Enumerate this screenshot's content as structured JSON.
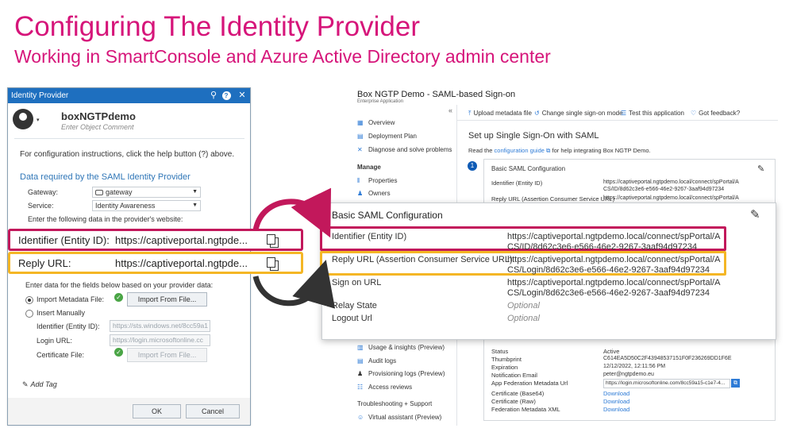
{
  "slide": {
    "title": "Configuring The Identity Provider",
    "subtitle": "Working in SmartConsole and Azure Active Directory admin center",
    "colors": {
      "accent": "#d6157a",
      "identifier_highlight": "#c2185b",
      "reply_highlight": "#f4b625"
    }
  },
  "dialog": {
    "window_title": "Identity Provider",
    "object_name": "boxNGTPdemo",
    "comment_placeholder": "Enter Object Comment",
    "help_text": "For configuration instructions, click the help button (?) above.",
    "section_title": "Data required by the SAML Identity Provider",
    "gateway_label": "Gateway:",
    "gateway_value": "gateway",
    "service_label": "Service:",
    "service_value": "Identity Awareness",
    "enter_data_text": "Enter the following data in the provider's website:",
    "fields_intro": "Enter data for the fields below based on your provider data:",
    "import_label": "Import Metadata File:",
    "import_button": "Import From File...",
    "manual_label": "Insert Manually",
    "identifier_label": "Identifier (Entity ID):",
    "identifier_value": "https://sts.windows.net/8cc59a1",
    "login_label": "Login URL:",
    "login_value": "https://login.microsoftonline.cc",
    "cert_label": "Certificate File:",
    "cert_button": "Import From File...",
    "add_tag": "Add Tag",
    "ok": "OK",
    "cancel": "Cancel",
    "icons": [
      "search-icon",
      "help-icon",
      "close-icon",
      "check-icon",
      "tag-icon",
      "copy-icon"
    ]
  },
  "highlights": {
    "identifier_label": "Identifier (Entity ID):",
    "identifier_value": "https://captiveportal.ngtpde...",
    "reply_label": "Reply URL:",
    "reply_value": "https://captiveportal.ngtpde..."
  },
  "azure": {
    "app_title": "Box NGTP Demo - SAML-based Sign-on",
    "app_subtitle": "Enterprise Application",
    "nav": [
      "Overview",
      "Deployment Plan",
      "Diagnose and solve problems"
    ],
    "manage_head": "Manage",
    "manage": [
      "Properties",
      "Owners"
    ],
    "activity": [
      "Usage & insights (Preview)",
      "Audit logs",
      "Provisioning logs (Preview)",
      "Access reviews"
    ],
    "troubleshoot_head": "Troubleshooting + Support",
    "troubleshoot": [
      "Virtual assistant (Preview)"
    ],
    "collapse": "«",
    "toolbar": [
      "Upload metadata file",
      "Change single sign-on mode",
      "Test this application",
      "Got feedback?"
    ],
    "heading": "Set up Single Sign-On with SAML",
    "read_prefix": "Read the",
    "read_link": "configuration guide",
    "read_suffix": "for help integrating Box NGTP Demo.",
    "step": "1",
    "card_title": "Basic SAML Configuration",
    "card_id_label": "Identifier (Entity ID)",
    "card_id_value": [
      "https://captiveportal.ngtpdemo.local/connect/spPortal/A",
      "CS/ID/8d62c3e6-e566-46e2-9267-3aaf94d97234"
    ],
    "card_reply_label": "Reply URL (Assertion Consumer Service URL)",
    "card_reply_value": [
      "https://captiveportal.ngtpdemo.local/connect/spPortal/A",
      "CS/Login/8d62c3e6-e566-46e2-9267-3aaf94d97234"
    ],
    "cert": {
      "status_label": "Status",
      "status_value": "Active",
      "thumb_label": "Thumbprint",
      "thumb_value": "C614EA5D50C2F43948537151F0F236269DD1F6E",
      "exp_label": "Expiration",
      "exp_value": "12/12/2022, 12:11:56 PM",
      "email_label": "Notification Email",
      "email_value": "peter@ngtpdemo.eu",
      "fed_label": "App Federation Metadata Url",
      "fed_value": "https://login.microsoftonline.com/8cc59a15-c1e7-4...",
      "b64_label": "Certificate (Base64)",
      "b64_value": "Download",
      "raw_label": "Certificate (Raw)",
      "raw_value": "Download",
      "xml_label": "Federation Metadata XML",
      "xml_value": "Download"
    }
  },
  "big_card": {
    "title": "Basic SAML Configuration",
    "identifier_label": "Identifier (Entity ID)",
    "identifier_value": [
      "https://captiveportal.ngtpdemo.local/connect/spPortal/A",
      "CS/ID/8d62c3e6-e566-46e2-9267-3aaf94d97234"
    ],
    "reply_label": "Reply URL (Assertion Consumer Service URL)",
    "reply_value": [
      "https://captiveportal.ngtpdemo.local/connect/spPortal/A",
      "CS/Login/8d62c3e6-e566-46e2-9267-3aaf94d97234"
    ],
    "signon_label": "Sign on URL",
    "signon_value": [
      "https://captiveportal.ngtpdemo.local/connect/spPortal/A",
      "CS/Login/8d62c3e6-e566-46e2-9267-3aaf94d97234"
    ],
    "relay_label": "Relay State",
    "relay_value": "Optional",
    "logout_label": "Logout Url",
    "logout_value": "Optional"
  }
}
